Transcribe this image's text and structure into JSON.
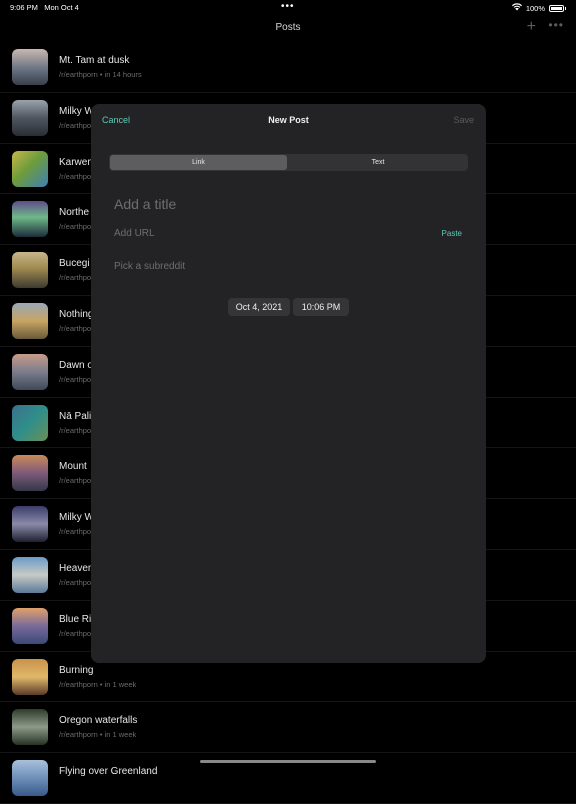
{
  "status_bar": {
    "time": "9:06 PM",
    "date": "Mon Oct 4",
    "battery": "100%"
  },
  "nav": {
    "title": "Posts"
  },
  "posts": [
    {
      "title": "Mt. Tam at dusk",
      "subtitle": "/r/earthporn • in 14 hours",
      "thumb": "linear-gradient(#c9b8b0,#6a7483 55%,#3a3f4a)"
    },
    {
      "title": "Milky W",
      "subtitle": "/r/earthpo",
      "thumb": "linear-gradient(#9aa2ab,#4f5660 50%,#2a2d33)"
    },
    {
      "title": "Karwen",
      "subtitle": "/r/earthpo",
      "thumb": "linear-gradient(135deg,#c9b84a,#6d9c3b 45%,#3f7fb4)"
    },
    {
      "title": "Northe",
      "subtitle": "/r/earthpo",
      "thumb": "linear-gradient(#5f4c8b,#6fb889 45%,#1c2c3a)"
    },
    {
      "title": "Bucegi",
      "subtitle": "/r/earthpo",
      "thumb": "linear-gradient(#c8b68c,#a08a50 45%,#3d3a30)"
    },
    {
      "title": "Nothing",
      "subtitle": "/r/earthpo",
      "thumb": "linear-gradient(#9ba8b6,#c7a462 50%,#6a5a3a)"
    },
    {
      "title": "Dawn o",
      "subtitle": "/r/earthpo",
      "thumb": "linear-gradient(#c89b8a,#7b7c8b 50%,#3e4a58)"
    },
    {
      "title": "Nā Pali",
      "subtitle": "/r/earthpo",
      "thumb": "linear-gradient(135deg,#3d6f8e,#2f8f8a 50%,#6b8f57)"
    },
    {
      "title": "Mount",
      "subtitle": "/r/earthpo",
      "thumb": "linear-gradient(#c98b5a,#7e5a7a 50%,#333848)"
    },
    {
      "title": "Milky W",
      "subtitle": "/r/earthpo",
      "thumb": "linear-gradient(#3a3c6a,#8a8aa8 50%,#1e2030)"
    },
    {
      "title": "Heaven",
      "subtitle": "/r/earthpo",
      "thumb": "linear-gradient(#6a9cc8,#c8c9c5 50%,#5a7a9a)"
    },
    {
      "title": "Blue Ri",
      "subtitle": "/r/earthpo",
      "thumb": "linear-gradient(#e0a06a,#7a6a9a 50%,#3a4a78)"
    },
    {
      "title": "Burning",
      "subtitle": "/r/earthporn • in 1 week",
      "thumb": "linear-gradient(#c9934a,#e0b86a 50%,#5a3a2a)"
    },
    {
      "title": "Oregon waterfalls",
      "subtitle": "/r/earthporn • in 1 week",
      "thumb": "linear-gradient(#2e3a2a,#8c9a8a 50%,#283224)"
    },
    {
      "title": "Flying over Greenland",
      "subtitle": "",
      "thumb": "linear-gradient(#a9c0dc,#6d8fb8 50%,#3a5a8a)"
    }
  ],
  "modal": {
    "cancel": "Cancel",
    "title": "New Post",
    "save": "Save",
    "segments": [
      "Link",
      "Text"
    ],
    "title_placeholder": "Add a title",
    "url_placeholder": "Add URL",
    "paste": "Paste",
    "subreddit_placeholder": "Pick a subreddit",
    "date": "Oct 4, 2021",
    "time": "10:06 PM"
  },
  "colors": {
    "accent": "#5ec9b8",
    "modal_bg": "#232325",
    "background": "#000000"
  }
}
